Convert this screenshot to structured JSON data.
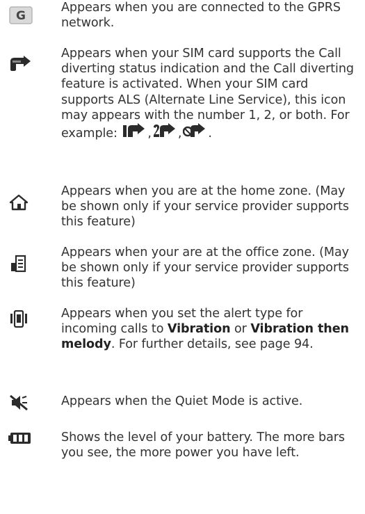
{
  "entries": [
    {
      "icon": "gprs-icon",
      "text": "Appears when you are connected to the GPRS network."
    },
    {
      "icon": "call-divert-icon",
      "text": "Appears when your SIM card supports the Call diverting status indication and the Call diverting feature is activated. When your SIM card supports ALS (Alternate Line Service), this icon may appears with the number 1, 2, or both. For example:",
      "example_icons": [
        "call-divert-line1-icon",
        "call-divert-line2-icon",
        "call-divert-both-icon"
      ],
      "example_separator": ",",
      "example_end": "."
    },
    {
      "icon": "home-zone-icon",
      "text": "Appears when you are at the home zone. (May be shown only if your service provider supports this feature)"
    },
    {
      "icon": "office-zone-icon",
      "text": "Appears when your are at the office zone. (May be shown only if your service provider supports this feature)"
    },
    {
      "icon": "vibration-icon",
      "text_pre": "Appears when you set the alert type for incoming calls to",
      "bold1": "Vibration",
      "text_or": "or",
      "bold2": "Vibration then melody",
      "text_post": ". For further details, see page 94."
    },
    {
      "icon": "quiet-mode-icon",
      "text": "Appears when the Quiet Mode is active."
    },
    {
      "icon": "battery-icon",
      "text": "Shows the level of your battery. The more bars you see, the more power you have left."
    }
  ]
}
